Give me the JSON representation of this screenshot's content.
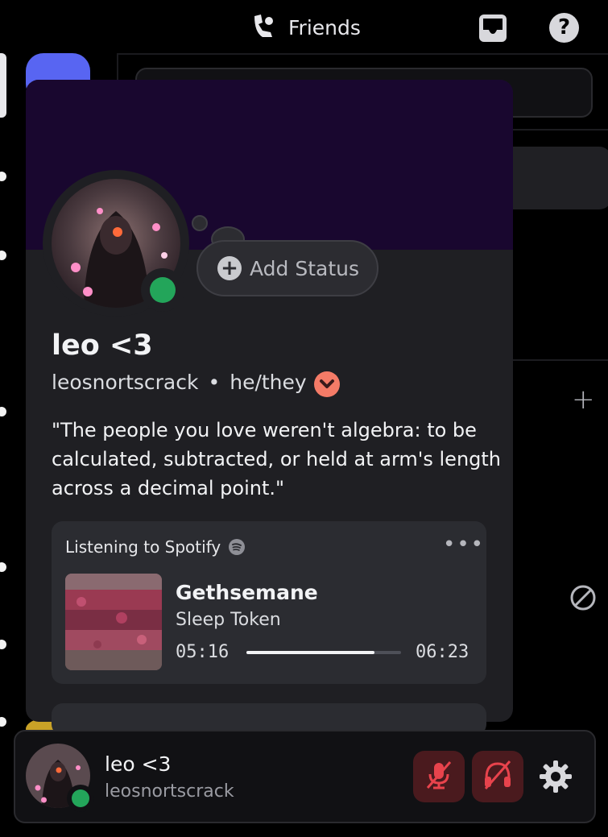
{
  "header": {
    "title": "Friends",
    "icons": [
      "friends-wave-icon",
      "inbox-icon",
      "help-icon"
    ],
    "help_glyph": "?"
  },
  "profile": {
    "add_status_label": "Add Status",
    "display_name": "leo <3",
    "username": "leosnortscrack",
    "separator": "•",
    "pronouns": "he/they",
    "bio": "\"The people you love weren't algebra: to be calculated, subtracted, or held at arm's length across a decimal point.\"",
    "status": "online"
  },
  "activity": {
    "heading": "Listening to Spotify",
    "more_label": "•••",
    "track_title": "Gethsemane",
    "artist": "Sleep Token",
    "elapsed": "05:16",
    "duration": "06:23",
    "progress_fraction": 0.83
  },
  "user_bar": {
    "display_name": "leo <3",
    "username": "leosnortscrack",
    "buttons": [
      "mute-microphone-icon",
      "deafen-headphones-icon",
      "settings-gear-icon"
    ]
  },
  "background": {
    "plus_glyph": "+"
  },
  "colors": {
    "banner": "#19072f",
    "card": "#1f1f23",
    "online": "#23a55a",
    "blurple": "#5865f2",
    "muted_button_bg": "#4a1a1e",
    "muted_icon": "#e8434c",
    "nitro_badge": "#f47b67"
  }
}
